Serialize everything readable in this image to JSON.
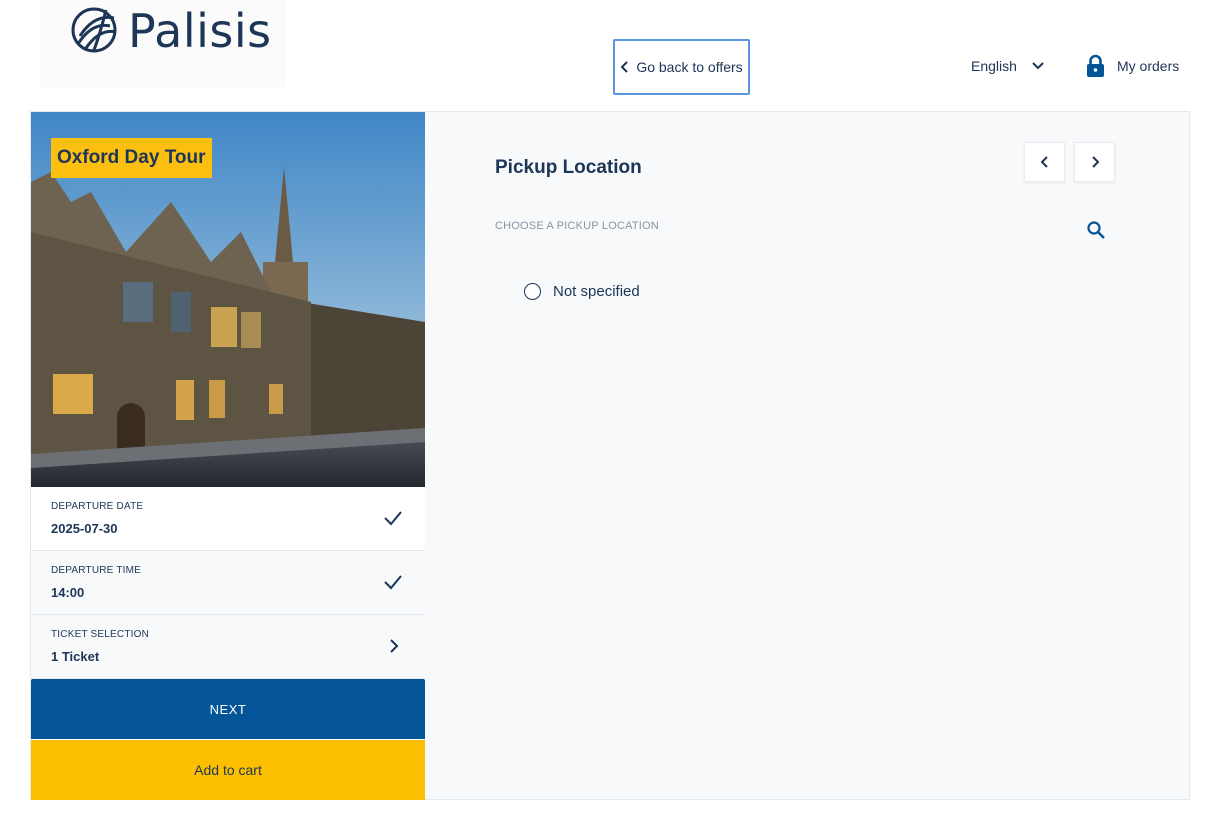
{
  "header": {
    "logo_text": "Palisis",
    "back_label": "Go back to offers",
    "language": "English",
    "orders_label": "My orders"
  },
  "tour": {
    "title": "Oxford Day Tour"
  },
  "steps": [
    {
      "label": "DEPARTURE DATE",
      "value": "2025-07-30",
      "icon": "check-icon"
    },
    {
      "label": "DEPARTURE TIME",
      "value": "14:00",
      "icon": "check-icon"
    },
    {
      "label": "TICKET SELECTION",
      "value": "1 Ticket",
      "icon": "chevron-right-icon"
    }
  ],
  "buttons": {
    "next": "NEXT",
    "add_to_cart": "Add to cart"
  },
  "pickup": {
    "title": "Pickup Location",
    "sub_label": "CHOOSE A PICKUP LOCATION",
    "options": [
      "Not specified"
    ]
  },
  "colors": {
    "accent_blue": "#045597",
    "accent_yellow": "#fcbf00",
    "text_navy": "#1d3557",
    "focus_outline": "#5b95df"
  }
}
